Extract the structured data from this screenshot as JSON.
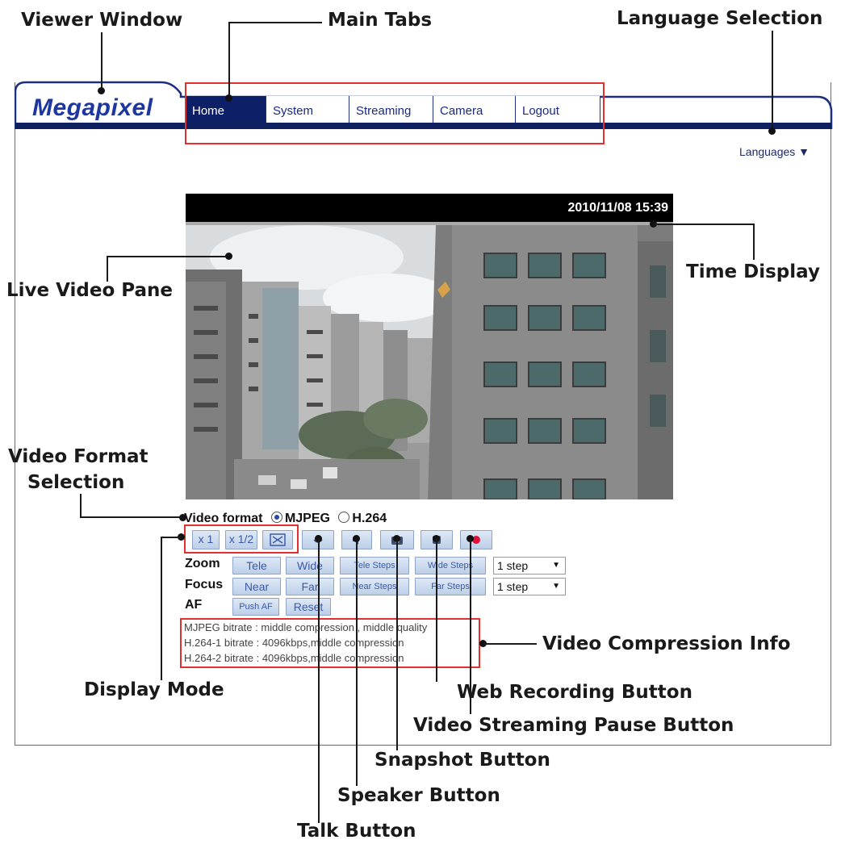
{
  "callouts": {
    "viewer_window": "Viewer Window",
    "main_tabs": "Main Tabs",
    "language_selection": "Language Selection",
    "live_video_pane": "Live Video Pane",
    "time_display": "Time Display",
    "video_format_selection_1": "Video Format",
    "video_format_selection_2": "Selection",
    "video_compression_info": "Video Compression Info",
    "display_mode": "Display Mode",
    "web_recording_button": "Web Recording Button",
    "pause_button": "Video Streaming Pause Button",
    "snapshot_button": "Snapshot Button",
    "speaker_button": "Speaker Button",
    "talk_button": "Talk Button"
  },
  "app": {
    "logo": "Megapixel"
  },
  "tabs": [
    {
      "label": "Home",
      "active": true
    },
    {
      "label": "System",
      "active": false
    },
    {
      "label": "Streaming",
      "active": false
    },
    {
      "label": "Camera",
      "active": false
    },
    {
      "label": "Logout",
      "active": false
    }
  ],
  "languages": {
    "label": "Languages ▼"
  },
  "video": {
    "timestamp": "2010/11/08 15:39"
  },
  "video_format": {
    "label": "Video format",
    "options": [
      "MJPEG",
      "H.264"
    ],
    "selected": "MJPEG"
  },
  "display_mode": {
    "x1": "x 1",
    "half": "x 1/2"
  },
  "icons": [
    "fullscreen-icon",
    "talk-icon",
    "speaker-icon",
    "snapshot-icon",
    "pause-icon",
    "record-icon"
  ],
  "controls": {
    "zoom": {
      "label": "Zoom",
      "b1": "Tele",
      "b2": "Wide",
      "b3": "Tele Steps",
      "b4": "Wide Steps",
      "select": "1 step"
    },
    "focus": {
      "label": "Focus",
      "b1": "Near",
      "b2": "Far",
      "b3": "Near Steps",
      "b4": "Far Steps",
      "select": "1 step"
    },
    "af": {
      "label": "AF",
      "b1": "Push AF",
      "b2": "Reset"
    }
  },
  "compression_info": [
    "MJPEG bitrate : middle compression , middle quality",
    "H.264-1 bitrate : 4096kbps,middle compression",
    "H.264-2 bitrate : 4096kbps,middle compression"
  ],
  "colors": {
    "accent": "#0d1f66",
    "logo": "#1d36a0",
    "callout_box": "#e03030",
    "record": "#e0103a"
  }
}
